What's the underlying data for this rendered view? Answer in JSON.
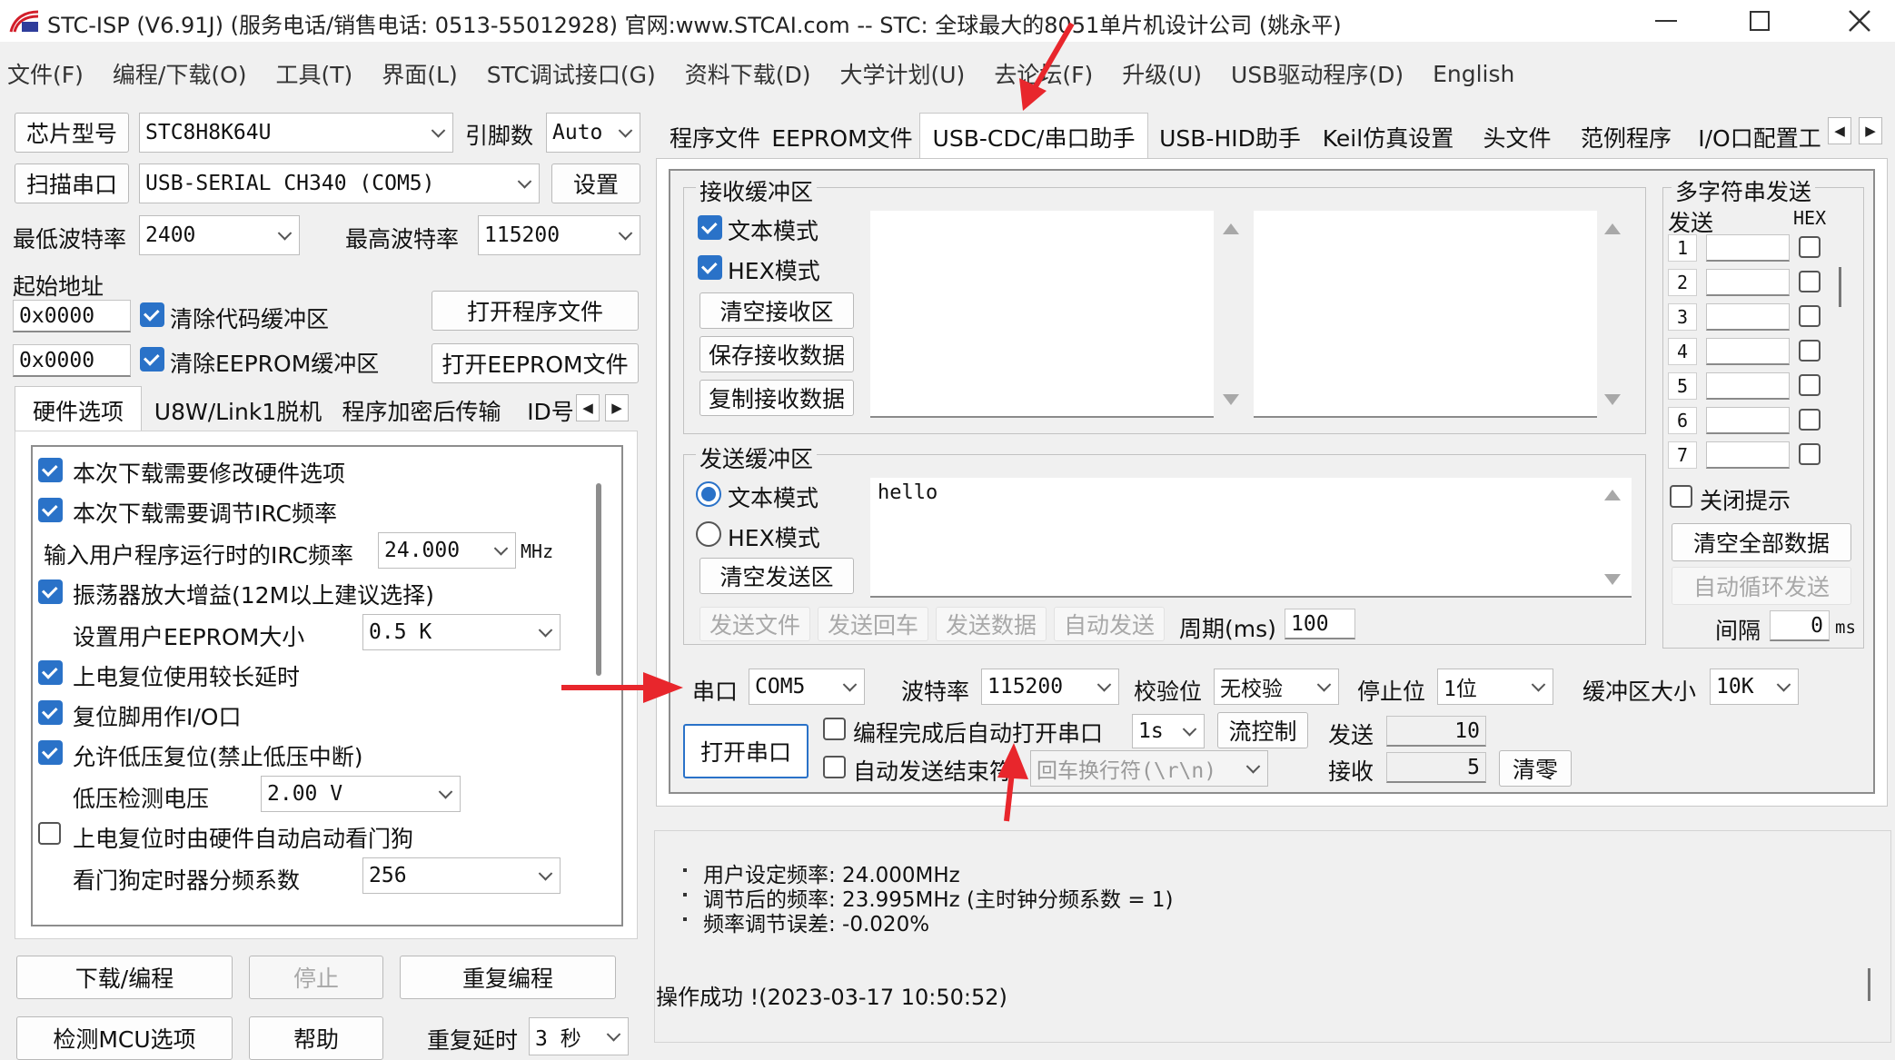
{
  "window": {
    "title": "STC-ISP (V6.91J) (服务电话/销售电话: 0513-55012928) 官网:www.STCAI.com  -- STC: 全球最大的8051单片机设计公司 (姚永平)"
  },
  "menu": [
    "文件(F)",
    "编程/下载(O)",
    "工具(T)",
    "界面(L)",
    "STC调试接口(G)",
    "资料下载(D)",
    "大学计划(U)",
    "去论坛(F)",
    "升级(U)",
    "USB驱动程序(D)",
    "English"
  ],
  "left": {
    "chip_label": "芯片型号",
    "chip_value": "STC8H8K64U",
    "pins_label": "引脚数",
    "pins_value": "Auto",
    "scan_btn": "扫描串口",
    "port_value": "USB-SERIAL CH340 (COM5)",
    "settings_btn": "设置",
    "min_baud_label": "最低波特率",
    "min_baud": "2400",
    "max_baud_label": "最高波特率",
    "max_baud": "115200",
    "start_addr_label": "起始地址",
    "addr1": "0x0000",
    "clear_code": "清除代码缓冲区",
    "open_prog": "打开程序文件",
    "addr2": "0x0000",
    "clear_eeprom": "清除EEPROM缓冲区",
    "open_eeprom": "打开EEPROM文件",
    "tabs": [
      "硬件选项",
      "U8W/Link1脱机",
      "程序加密后传输",
      "ID号"
    ],
    "hw": {
      "opt1": "本次下载需要修改硬件选项",
      "opt2": "本次下载需要调节IRC频率",
      "irc_label": "输入用户程序运行时的IRC频率",
      "irc_value": "24.000",
      "irc_unit": "MHz",
      "opt3": "振荡器放大增益(12M以上建议选择)",
      "eeprom_label": "设置用户EEPROM大小",
      "eeprom_value": "0.5 K",
      "opt4": "上电复位使用较长延时",
      "opt5": "复位脚用作I/O口",
      "opt6": "允许低压复位(禁止低压中断)",
      "lv_label": "低压检测电压",
      "lv_value": "2.00 V",
      "opt7": "上电复位时由硬件自动启动看门狗",
      "wdt_label": "看门狗定时器分频系数",
      "wdt_value": "256"
    },
    "download_btn": "下载/编程",
    "stop_btn": "停止",
    "reprog_btn": "重复编程",
    "detect_btn": "检测MCU选项",
    "help_btn": "帮助",
    "delay_label": "重复延时",
    "delay_value": "3 秒"
  },
  "right": {
    "tabs": [
      "程序文件",
      "EEPROM文件",
      "USB-CDC/串口助手",
      "USB-HID助手",
      "Keil仿真设置",
      "头文件",
      "范例程序",
      "I/O口配置工"
    ],
    "recv": {
      "title": "接收缓冲区",
      "text_mode": "文本模式",
      "hex_mode": "HEX模式",
      "clear": "清空接收区",
      "save": "保存接收数据",
      "copy": "复制接收数据"
    },
    "send": {
      "title": "发送缓冲区",
      "text_mode": "文本模式",
      "hex_mode": "HEX模式",
      "clear": "清空发送区",
      "content": "hello",
      "send_file": "发送文件",
      "send_cr": "发送回车",
      "send_data": "发送数据",
      "auto_send": "自动发送",
      "period_label": "周期(ms)",
      "period_value": "100"
    },
    "multi": {
      "title": "多字符串发送",
      "send_label": "发送",
      "hex_label": "HEX",
      "rows": [
        "1",
        "2",
        "3",
        "4",
        "5",
        "6",
        "7"
      ],
      "close_tip": "关闭提示",
      "clear_all": "清空全部数据",
      "auto_loop": "自动循环发送",
      "interval_label": "间隔",
      "interval_value": "0",
      "interval_unit": "ms"
    },
    "port": {
      "port_label": "串口",
      "port_value": "COM5",
      "baud_label": "波特率",
      "baud_value": "115200",
      "parity_label": "校验位",
      "parity_value": "无校验",
      "stop_label": "停止位",
      "stop_value": "1位",
      "buf_label": "缓冲区大小",
      "buf_value": "10K",
      "open_btn": "打开串口",
      "auto_open": "编程完成后自动打开串口",
      "auto_open_value": "1s",
      "flow_btn": "流控制",
      "send_label": "发送",
      "send_count": "10",
      "auto_end": "自动发送结束符",
      "end_value": "回车换行符(\\r\\n)",
      "recv_label": "接收",
      "recv_count": "5",
      "clear_btn": "清零"
    },
    "log": {
      "line1": "用户设定频率: 24.000MHz",
      "line2": "调节后的频率: 23.995MHz (主时钟分频系数 = 1)",
      "line3": "频率调节误差: -0.020%",
      "status": "操作成功 !(2023-03-17 10:50:52)"
    }
  },
  "colors": {
    "accent": "#2a72c8",
    "arrow": "#e8262c"
  }
}
